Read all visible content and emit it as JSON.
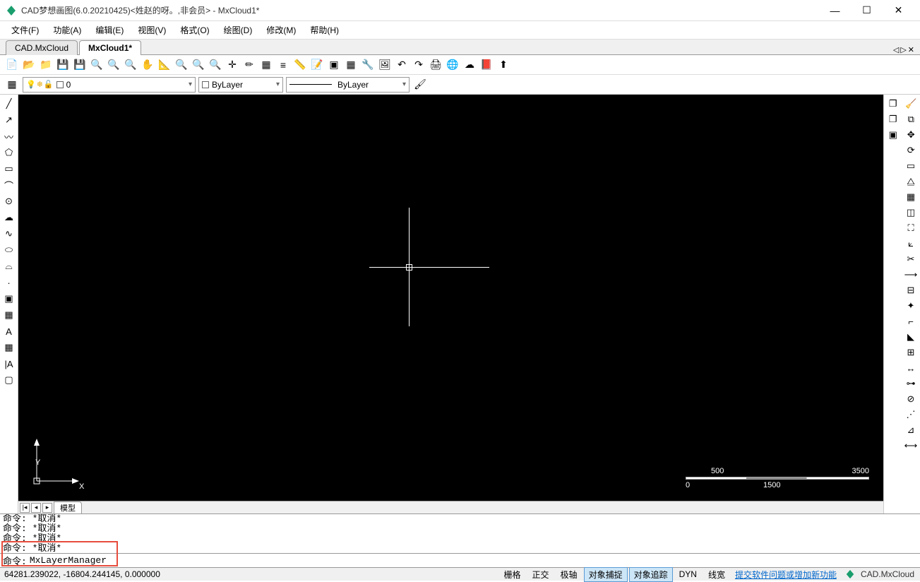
{
  "title": "CAD梦想画图(6.0.20210425)<姓赵的呀。,非会员> - MxCloud1*",
  "menu": [
    "文件(F)",
    "功能(A)",
    "编辑(E)",
    "视图(V)",
    "格式(O)",
    "绘图(D)",
    "修改(M)",
    "帮助(H)"
  ],
  "tabs": [
    {
      "label": "CAD.MxCloud",
      "active": false
    },
    {
      "label": "MxCloud1*",
      "active": true
    }
  ],
  "layer_combo": "0",
  "color_combo": "ByLayer",
  "linetype_combo": "ByLayer",
  "model_tab": "模型",
  "ucs_y": "Y",
  "ucs_x": "X",
  "scale": {
    "n500": "500",
    "n3500": "3500",
    "n0": "0",
    "n1500": "1500"
  },
  "cmdlog": [
    "命令: *取消*",
    "命令: *取消*",
    "命令: *取消*",
    "命令: *取消*"
  ],
  "cmd_prompt": "命令:",
  "cmd_value": "MxLayerManager",
  "coords": "64281.239022,  -16804.244145,  0.000000",
  "status": {
    "grid": "栅格",
    "ortho": "正交",
    "polar": "极轴",
    "osnap": "对象捕捉",
    "otrack": "对象追踪",
    "dyn": "DYN",
    "lwt": "线宽"
  },
  "feedback_link": "提交软件问题或增加新功能",
  "brand": "CAD.MxCloud",
  "win": {
    "min": "—",
    "max": "☐",
    "close": "✕"
  },
  "tabnav": {
    "left": "◁",
    "right": "▷",
    "close": "✕"
  }
}
